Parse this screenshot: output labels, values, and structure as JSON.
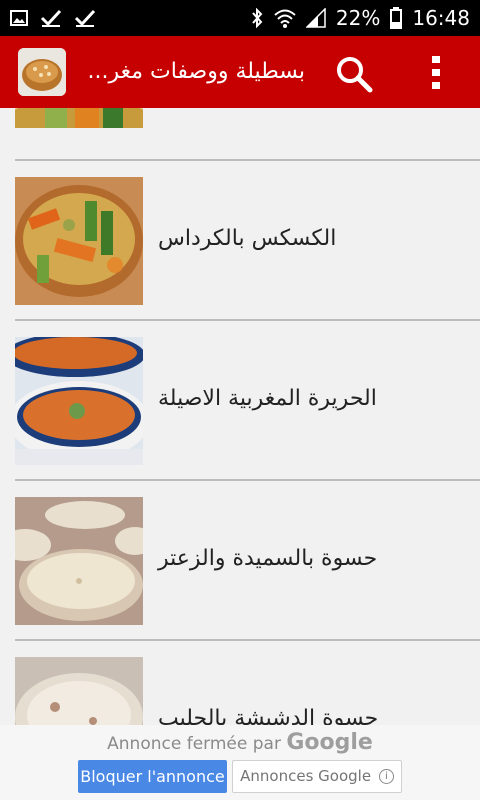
{
  "statusbar": {
    "battery": "22%",
    "time": "16:48",
    "icons": [
      "image-icon",
      "check-icon",
      "check-icon",
      "bluetooth-icon",
      "wifi-icon",
      "signal-icon",
      "battery-icon"
    ]
  },
  "appbar": {
    "title": "بسطيلة ووصفات مغر...",
    "color": "#c60000"
  },
  "list": {
    "items": [
      {
        "title": ""
      },
      {
        "title": "الكسكس بالكرداس"
      },
      {
        "title": "الحريرة المغربية الاصيلة"
      },
      {
        "title": "حسوة بالسميدة والزعتر"
      },
      {
        "title": "حسوة الدشيشة بالحليب"
      }
    ]
  },
  "ad": {
    "closed_text": "Annonce fermée par",
    "google_word": "Google",
    "block_label": "Bloquer l'annonce",
    "google_ads_label": "Annonces Google"
  }
}
